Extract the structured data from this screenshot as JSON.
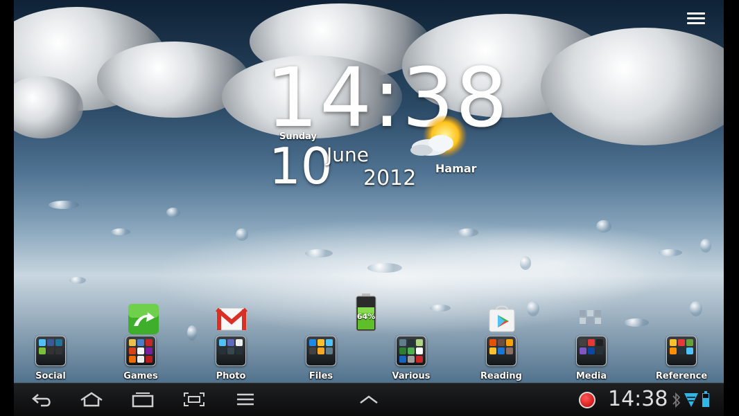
{
  "clock_widget": {
    "time": "14:38",
    "day": "Sunday",
    "date": "10",
    "month": "June",
    "year": "2012",
    "city": "Hamar"
  },
  "shortcuts": [
    {
      "name": "dolphin-browser-icon",
      "color": "#3fae2a"
    },
    {
      "name": "gmail-icon",
      "color": "#d93025"
    },
    {
      "name": "battery-widget",
      "label": "64%",
      "color": "#5fbf2a"
    },
    {
      "name": "play-store-icon",
      "color": "#39b54a"
    },
    {
      "name": "app-drawer-grid-icon",
      "color": "#9aa8b5"
    }
  ],
  "folders": [
    {
      "label": "Social"
    },
    {
      "label": "Games"
    },
    {
      "label": "Photo"
    },
    {
      "label": "Files"
    },
    {
      "label": "Various"
    },
    {
      "label": "Reading"
    },
    {
      "label": "Media"
    },
    {
      "label": "Reference"
    }
  ],
  "navbar": {
    "buttons": [
      "back-button",
      "home-button",
      "recent-apps-button",
      "screenshot-button",
      "menu-button"
    ],
    "status_time": "14:38",
    "accent": "#33b5e5"
  }
}
